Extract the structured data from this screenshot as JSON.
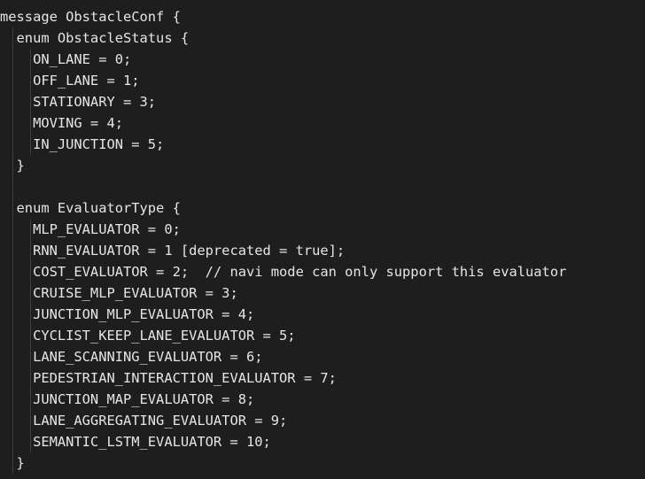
{
  "code": {
    "lines": [
      "message ObstacleConf {",
      "  enum ObstacleStatus {",
      "    ON_LANE = 0;",
      "    OFF_LANE = 1;",
      "    STATIONARY = 3;",
      "    MOVING = 4;",
      "    IN_JUNCTION = 5;",
      "  }",
      "",
      "  enum EvaluatorType {",
      "    MLP_EVALUATOR = 0;",
      "    RNN_EVALUATOR = 1 [deprecated = true];",
      "    COST_EVALUATOR = 2;  // navi mode can only support this evaluator",
      "    CRUISE_MLP_EVALUATOR = 3;",
      "    JUNCTION_MLP_EVALUATOR = 4;",
      "    CYCLIST_KEEP_LANE_EVALUATOR = 5;",
      "    LANE_SCANNING_EVALUATOR = 6;",
      "    PEDESTRIAN_INTERACTION_EVALUATOR = 7;",
      "    JUNCTION_MAP_EVALUATOR = 8;",
      "    LANE_AGGREGATING_EVALUATOR = 9;",
      "    SEMANTIC_LSTM_EVALUATOR = 10;",
      "  }"
    ]
  }
}
